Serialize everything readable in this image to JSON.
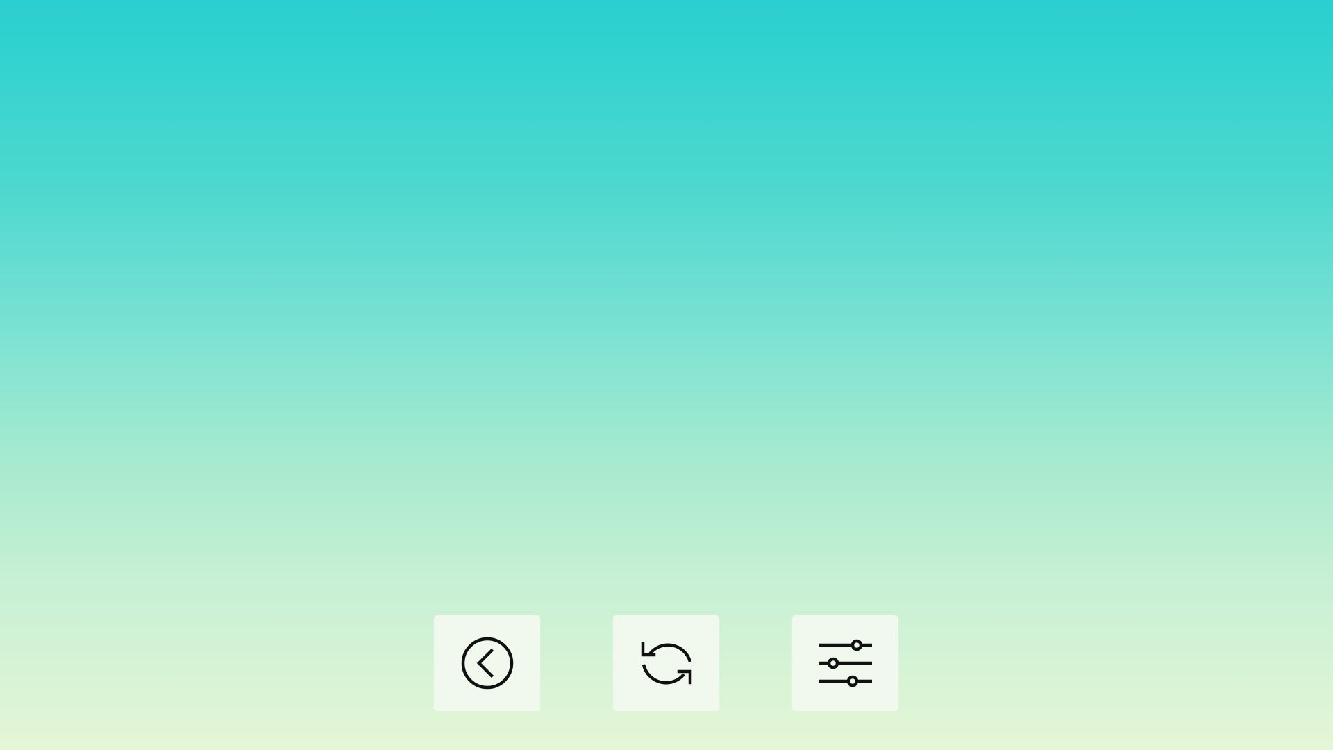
{
  "screen": {
    "background_top_color": "#2ccfcf",
    "background_bottom_color": "#e4f6d6"
  },
  "toolbar": {
    "button_background": "#f1f8ee",
    "icon_color": "#111111",
    "buttons": [
      {
        "icon": "chevron-left-circle-icon"
      },
      {
        "icon": "refresh-icon"
      },
      {
        "icon": "sliders-icon"
      }
    ]
  }
}
